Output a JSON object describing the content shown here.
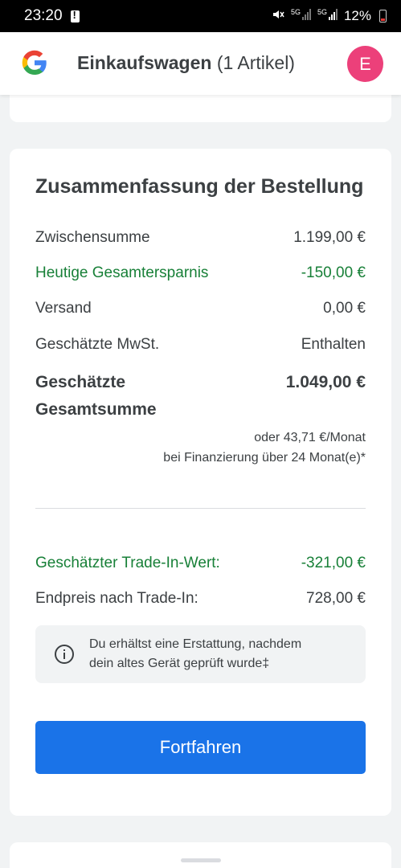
{
  "status_bar": {
    "time": "23:20",
    "network_1": "5G",
    "network_2": "5G",
    "battery": "12%"
  },
  "app_bar": {
    "title": "Einkaufswagen",
    "count": "(1 Artikel)",
    "avatar_letter": "E",
    "avatar_color": "#ec407a"
  },
  "summary": {
    "title": "Zusammenfassung der Bestellung",
    "rows": [
      {
        "label": "Zwischensumme",
        "value": "1.199,00 €"
      },
      {
        "label": "Heutige Gesamtersparnis",
        "value": "-150,00 €"
      },
      {
        "label": "Versand",
        "value": "0,00 €"
      },
      {
        "label": "Geschätzte MwSt.",
        "value": "Enthalten"
      }
    ],
    "total_label": "Geschätzte Gesamtsumme",
    "total_value": "1.049,00 €",
    "finance_line1": "oder 43,71 €/Monat",
    "finance_line2": "bei Finanzierung über 24 Monat(e)*"
  },
  "trade_in": {
    "value_label": "Geschätzter Trade-In-Wert:",
    "value": "-321,00 €",
    "final_label": "Endpreis nach Trade-In:",
    "final_value": "728,00 €",
    "info_line1": "Du erhältst eine Erstattung, nachdem",
    "info_line2": "dein altes Gerät geprüft wurde‡"
  },
  "continue_button": "Fortfahren",
  "colors": {
    "accent": "#1a73e8",
    "savings_green": "#188038"
  }
}
